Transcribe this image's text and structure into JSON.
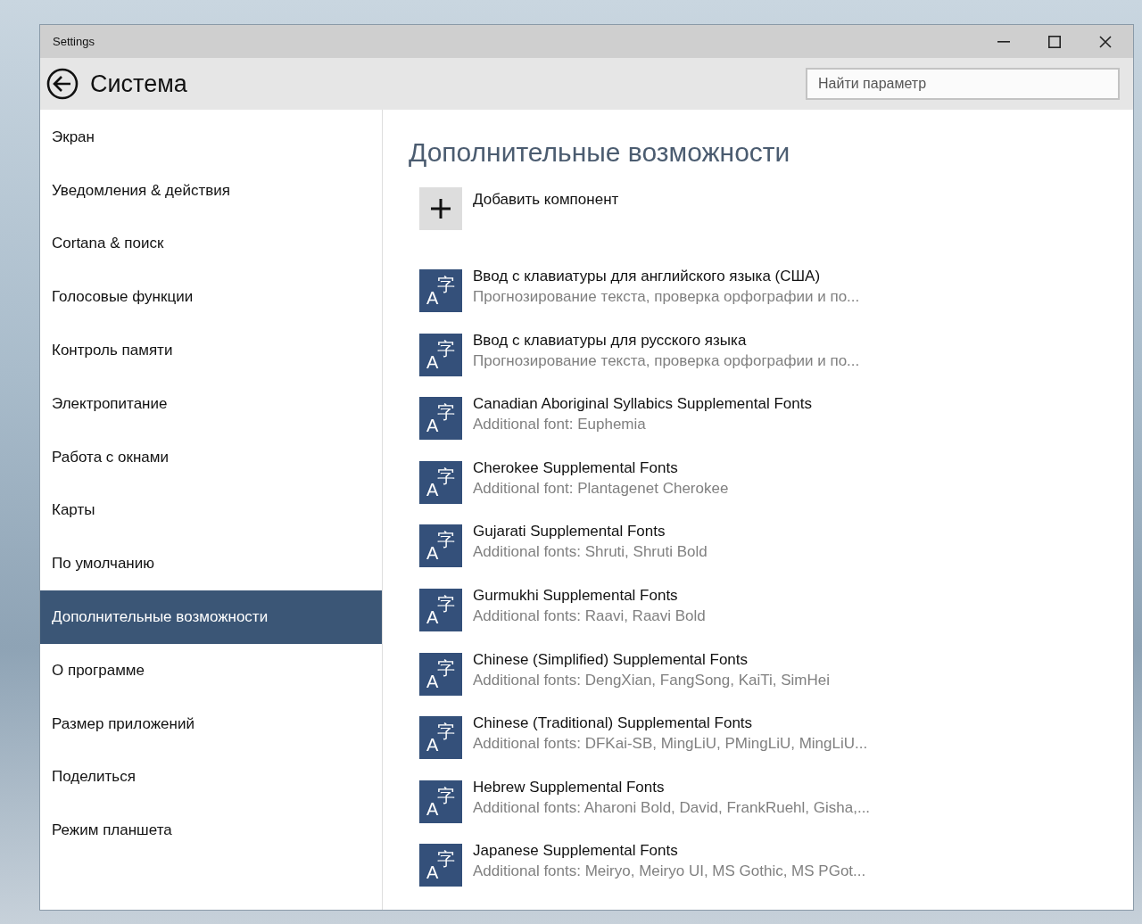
{
  "window": {
    "title": "Settings"
  },
  "header": {
    "title": "Система",
    "search": {
      "placeholder": "Найти параметр"
    }
  },
  "sidebar": {
    "items": [
      {
        "label": "Экран",
        "selected": false
      },
      {
        "label": "Уведомления & действия",
        "selected": false
      },
      {
        "label": "Cortana & поиск",
        "selected": false
      },
      {
        "label": "Голосовые функции",
        "selected": false
      },
      {
        "label": "Контроль памяти",
        "selected": false
      },
      {
        "label": "Электропитание",
        "selected": false
      },
      {
        "label": "Работа с окнами",
        "selected": false
      },
      {
        "label": "Карты",
        "selected": false
      },
      {
        "label": "По умолчанию",
        "selected": false
      },
      {
        "label": "Дополнительные возможности",
        "selected": true
      },
      {
        "label": "О программе",
        "selected": false
      },
      {
        "label": "Размер приложений",
        "selected": false
      },
      {
        "label": "Поделиться",
        "selected": false
      },
      {
        "label": "Режим планшета",
        "selected": false
      }
    ]
  },
  "content": {
    "heading": "Дополнительные возможности",
    "add_button": {
      "label": "Добавить компонент"
    },
    "features": [
      {
        "icon": [
          "A",
          "字"
        ],
        "title": "Ввод с клавиатуры для английского языка (США)",
        "subtitle": "Прогнозирование текста, проверка орфографии и по..."
      },
      {
        "icon": [
          "A",
          "字"
        ],
        "title": "Ввод с клавиатуры для русского языка",
        "subtitle": "Прогнозирование текста, проверка орфографии и по..."
      },
      {
        "icon": [
          "A",
          "字"
        ],
        "title": "Canadian Aboriginal Syllabics Supplemental Fonts",
        "subtitle": "Additional font: Euphemia"
      },
      {
        "icon": [
          "A",
          "字"
        ],
        "title": "Cherokee Supplemental Fonts",
        "subtitle": "Additional font: Plantagenet Cherokee"
      },
      {
        "icon": [
          "A",
          "字"
        ],
        "title": "Gujarati Supplemental Fonts",
        "subtitle": "Additional fonts: Shruti, Shruti Bold"
      },
      {
        "icon": [
          "A",
          "字"
        ],
        "title": "Gurmukhi Supplemental Fonts",
        "subtitle": "Additional fonts: Raavi, Raavi Bold"
      },
      {
        "icon": [
          "A",
          "字"
        ],
        "title": "Chinese (Simplified) Supplemental Fonts",
        "subtitle": "Additional fonts: DengXian, FangSong, KaiTi, SimHei"
      },
      {
        "icon": [
          "A",
          "字"
        ],
        "title": "Chinese (Traditional) Supplemental Fonts",
        "subtitle": "Additional fonts: DFKai-SB, MingLiU, PMingLiU, MingLiU..."
      },
      {
        "icon": [
          "A",
          "字"
        ],
        "title": "Hebrew Supplemental Fonts",
        "subtitle": "Additional fonts: Aharoni Bold, David, FrankRuehl, Gisha,..."
      },
      {
        "icon": [
          "A",
          "字"
        ],
        "title": "Japanese Supplemental Fonts",
        "subtitle": "Additional fonts: Meiryo, Meiryo UI, MS Gothic, MS PGot..."
      }
    ]
  }
}
